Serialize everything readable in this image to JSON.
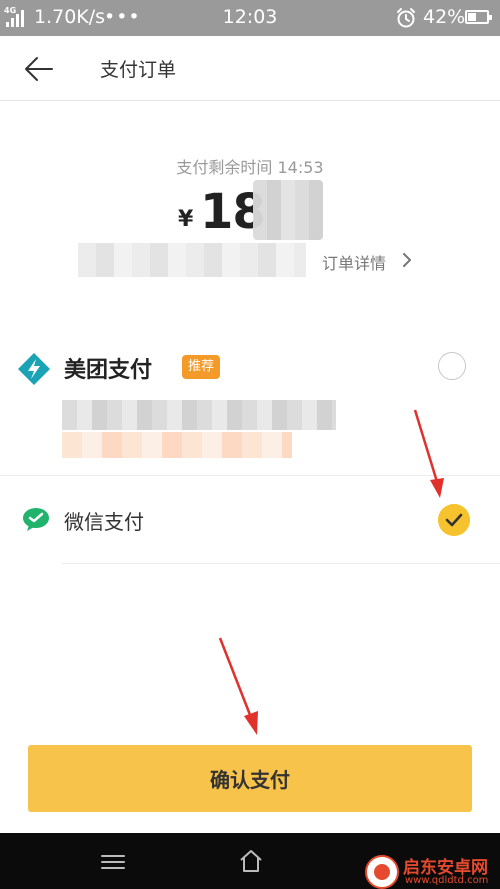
{
  "status_bar": {
    "network": "4G",
    "speed": "1.70K/s",
    "more": "•••",
    "time": "12:03",
    "battery_percent": "42%",
    "battery_level": 0.42,
    "icons": [
      "signal-icon",
      "alarm-icon",
      "battery-icon"
    ]
  },
  "header": {
    "back_icon": "back-arrow-icon",
    "title": "支付订单"
  },
  "order": {
    "remaining_time_label": "支付剩余时间 14:53",
    "currency": "¥",
    "amount": "18",
    "detail_link": "订单详情",
    "detail_icon": "chevron-right-icon"
  },
  "payment_methods": [
    {
      "name": "美团支付",
      "badge": "推荐",
      "icon": "meituan-pay-icon",
      "selected": false
    },
    {
      "name": "微信支付",
      "icon": "wechat-pay-icon",
      "selected": true
    }
  ],
  "confirm_button": "确认支付",
  "nav_bar": {
    "icons": [
      "menu-icon",
      "home-icon"
    ]
  },
  "watermark": {
    "name": "启东安卓网",
    "url": "www.qdldtd.com"
  },
  "colors": {
    "status_bar": "#9a9a9a",
    "confirm_button": "#f7c34a",
    "selected_check": "#f6c32e",
    "badge": "#f39a28",
    "meituan_icon": "#1aa3b5",
    "wechat_icon": "#21b26b",
    "annotation_arrow": "#e0312c"
  }
}
